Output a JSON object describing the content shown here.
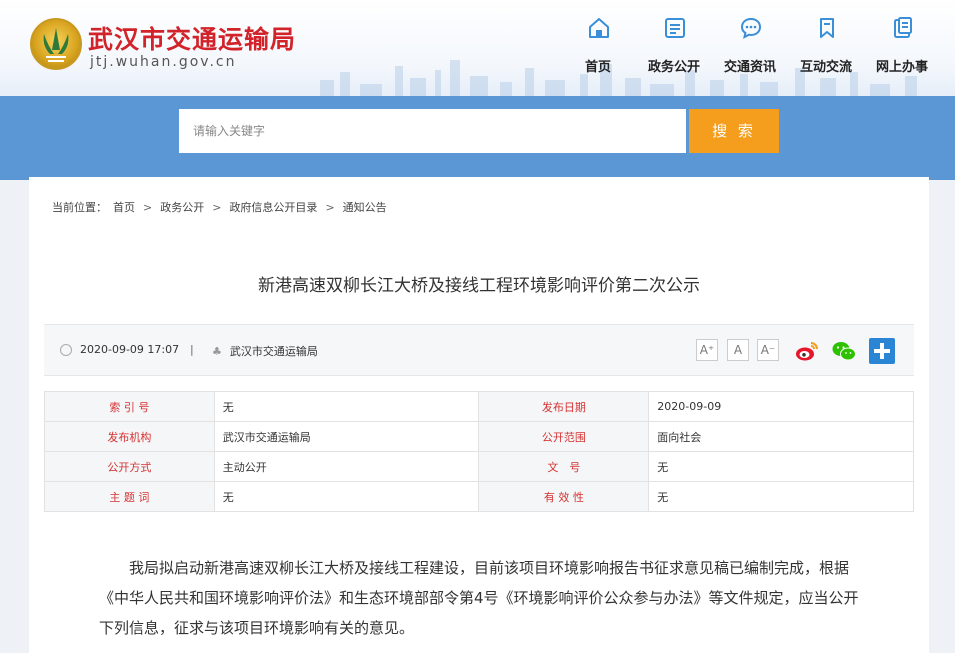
{
  "site": {
    "title": "武汉市交通运输局",
    "domain": "jtj.wuhan.gov.cn"
  },
  "nav": [
    {
      "label": "首页",
      "icon": "home-icon"
    },
    {
      "label": "政务公开",
      "icon": "document-icon"
    },
    {
      "label": "交通资讯",
      "icon": "chat-bubble-icon"
    },
    {
      "label": "互动交流",
      "icon": "bookmark-icon"
    },
    {
      "label": "网上办事",
      "icon": "clipboard-icon"
    }
  ],
  "search": {
    "placeholder": "请输入关键字",
    "button": "搜 索"
  },
  "breadcrumb": {
    "prefix": "当前位置：",
    "items": [
      "首页",
      "政务公开",
      "政府信息公开目录",
      "通知公告"
    ],
    "separator": ">"
  },
  "article": {
    "title": "新港高速双柳长江大桥及接线工程环境影响评价第二次公示",
    "datetime": "2020-09-09 17:07",
    "divider": "|",
    "source": "武汉市交通运输局",
    "font_controls": [
      "A⁺",
      "A",
      "A⁻"
    ],
    "share_icons": [
      "weibo-icon",
      "wechat-icon",
      "plus-share-icon"
    ]
  },
  "info_table": [
    {
      "k1": "索 引 号",
      "v1": "无",
      "k2": "发布日期",
      "v2": "2020-09-09"
    },
    {
      "k1": "发布机构",
      "v1": "武汉市交通运输局",
      "k2": "公开范围",
      "v2": "面向社会"
    },
    {
      "k1": "公开方式",
      "v1": "主动公开",
      "k2": "文　号",
      "v2": "无"
    },
    {
      "k1": "主 题 词",
      "v1": "无",
      "k2": "有 效 性",
      "v2": "无"
    }
  ],
  "content": {
    "paragraph": "我局拟启动新港高速双柳长江大桥及接线工程建设，目前该项目环境影响报告书征求意见稿已编制完成，根据《中华人民共和国环境影响评价法》和生态环境部部令第4号《环境影响评价公众参与办法》等文件规定，应当公开下列信息，征求与该项目环境影响有关的意见。"
  },
  "colors": {
    "title_red": "#d2232a",
    "band_blue": "#5b97d5",
    "search_orange": "#f59d1d",
    "icon_blue": "#3a8fd8",
    "table_key_red": "#d43232"
  }
}
